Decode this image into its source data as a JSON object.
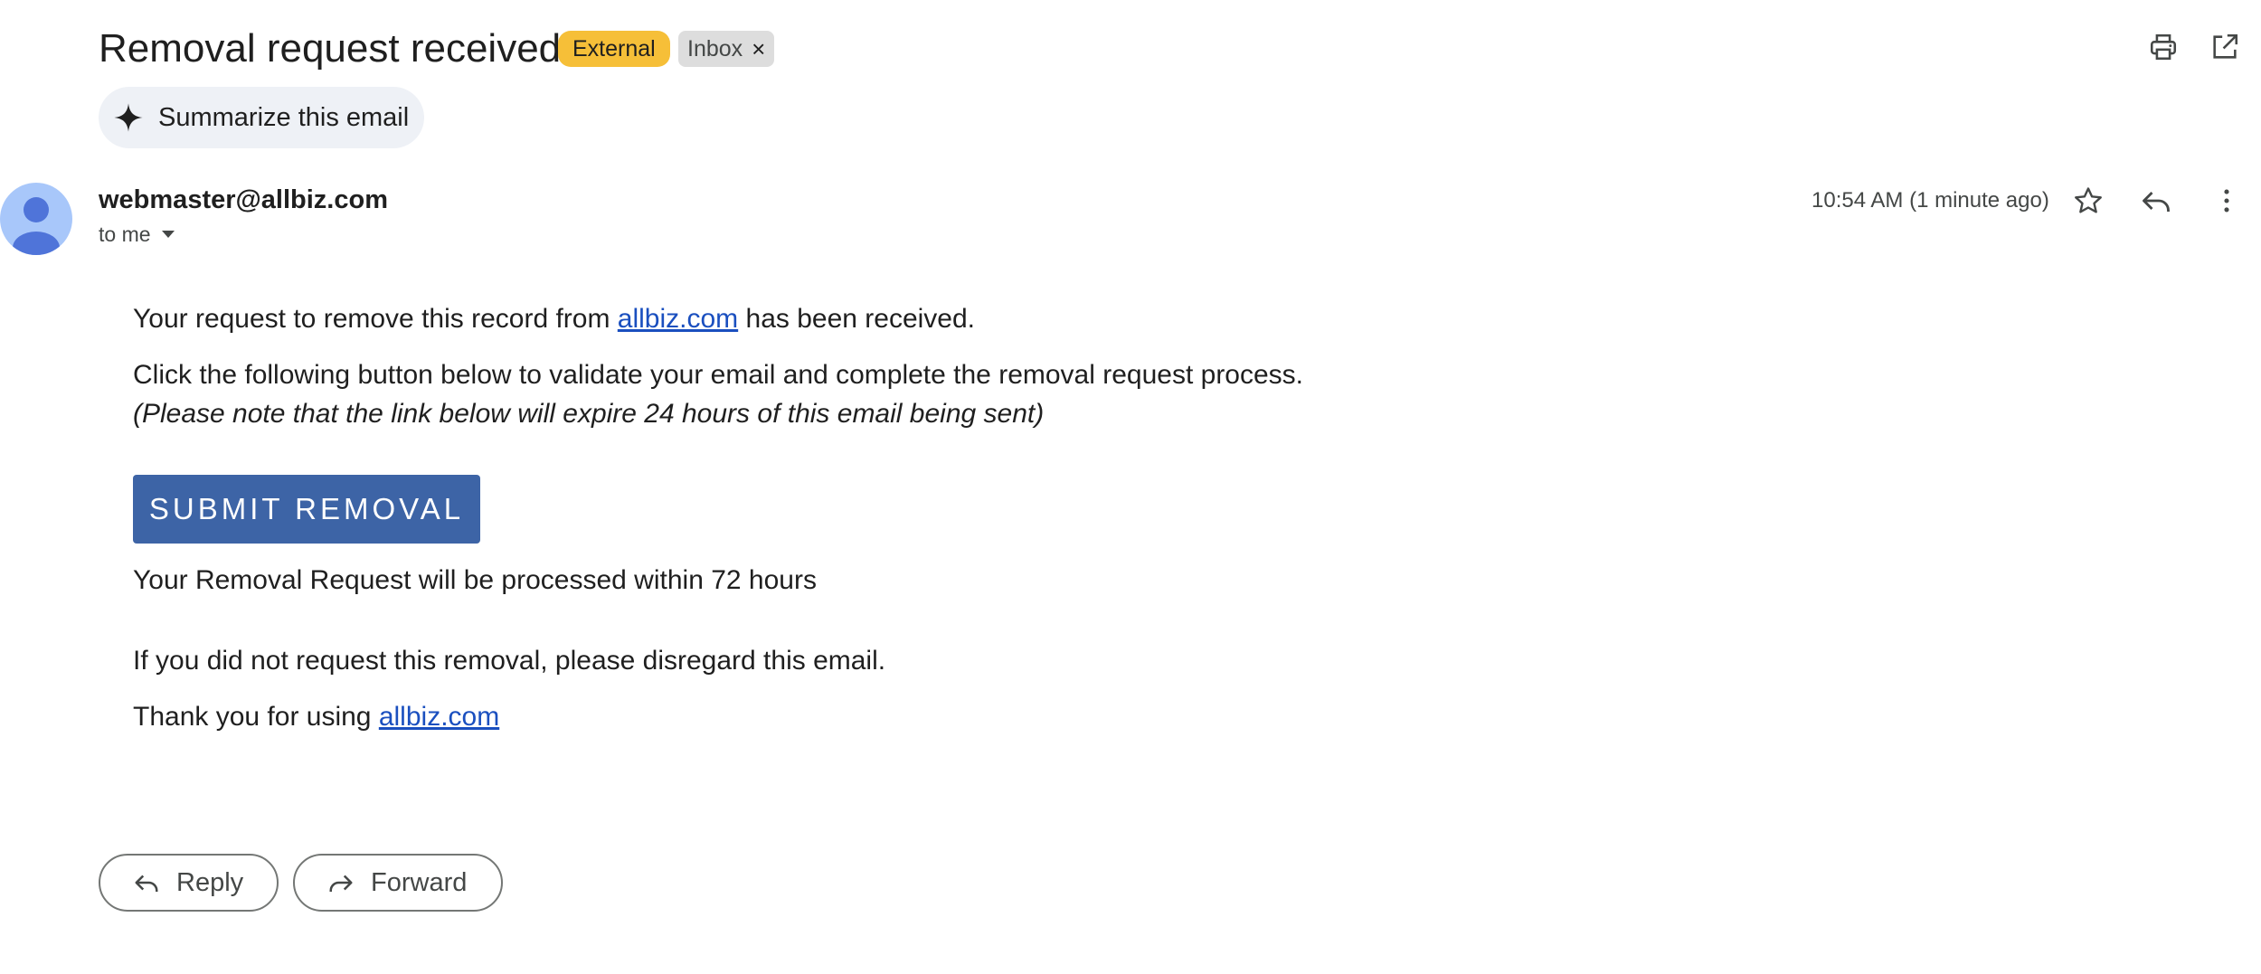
{
  "email": {
    "subject": "Removal request received",
    "labels": {
      "external": "External",
      "inbox": "Inbox",
      "remove_label_glyph": "×"
    },
    "summarize_label": "Summarize this email",
    "sender": "webmaster@allbiz.com",
    "recipient_label": "to me",
    "timestamp": "10:54 AM (1 minute ago)"
  },
  "body": {
    "p1_before": "Your request to remove this record from ",
    "p1_link": "allbiz.com",
    "p1_after": " has been received.",
    "p2": "Click the following button below to validate your email and complete the removal request process.",
    "p3": "(Please note that the link below will expire 24 hours of this email being sent)",
    "submit_label": "SUBMIT REMOVAL",
    "p4": "Your Removal Request will be processed within 72 hours",
    "p5": "If you did not request this removal, please disregard this email.",
    "p6_before": "Thank you for using ",
    "p6_link": "allbiz.com"
  },
  "actions": {
    "reply_label": "Reply",
    "forward_label": "Forward"
  },
  "icons": {
    "print": "print-icon",
    "open_new_window": "open-in-new-icon",
    "sparkle": "sparkle-icon",
    "star": "star-icon",
    "reply": "reply-icon",
    "more": "more-vert-icon",
    "dropdown": "caret-down-icon",
    "forward": "forward-icon",
    "avatar": "person-icon"
  },
  "colors": {
    "external_badge": "#f6bf38",
    "inbox_badge": "#dddddd",
    "link": "#1a4fbf",
    "submit_button": "#3d64a6",
    "avatar_bg": "#a8c7fa",
    "avatar_fg": "#4f74d9"
  }
}
